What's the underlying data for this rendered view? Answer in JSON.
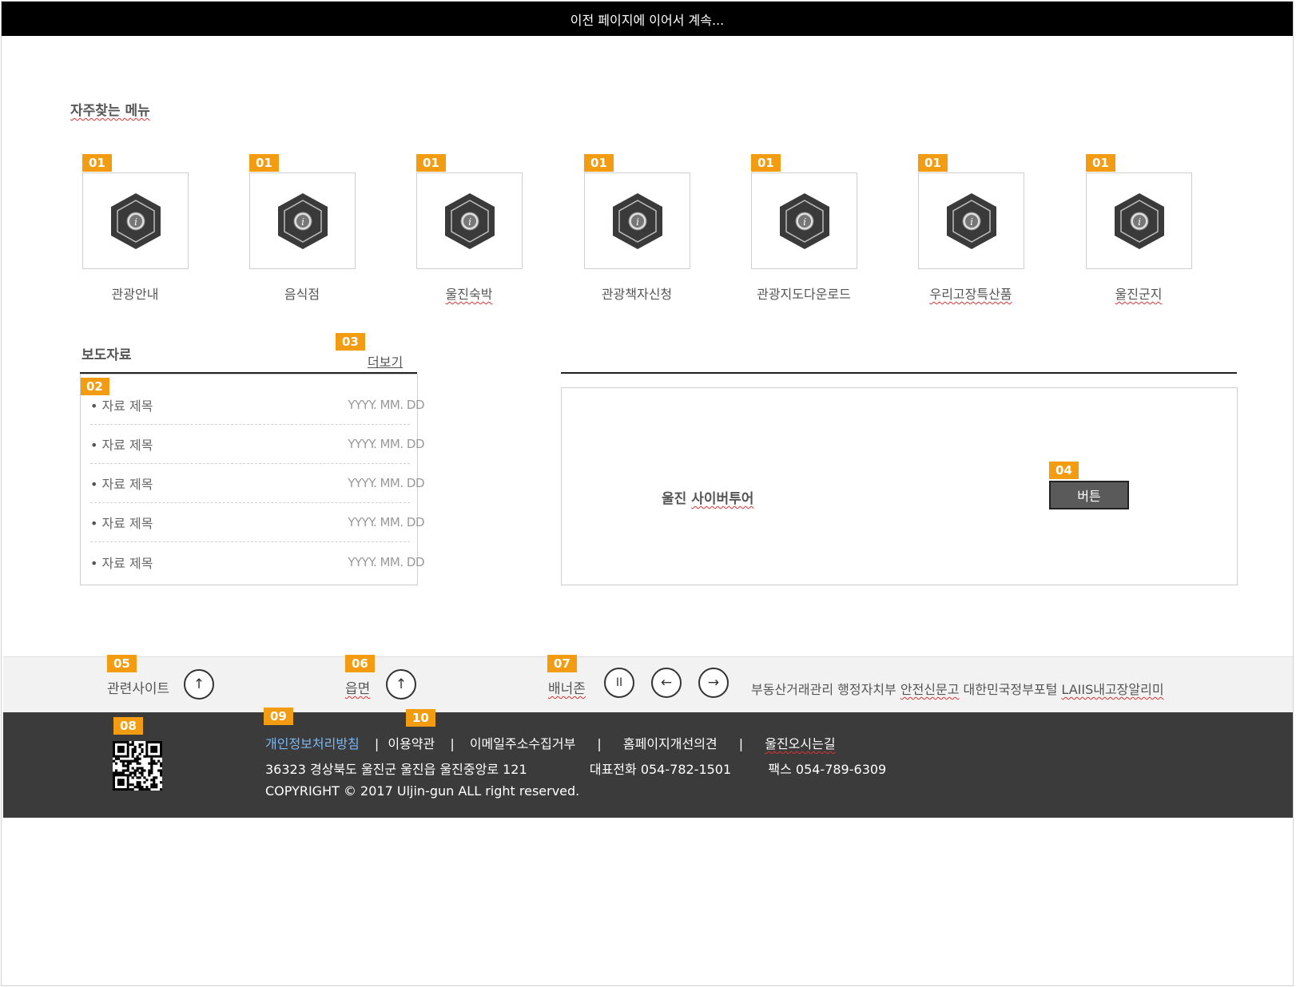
{
  "top_bar": {
    "text": "이전 페이지에 이어서 계속..."
  },
  "quick_menu": {
    "title": "자주찾는 메뉴",
    "items": [
      {
        "badge": "01",
        "label": "관광안내",
        "icon": "info-hexagon-icon"
      },
      {
        "badge": "01",
        "label": "음식점",
        "icon": "info-hexagon-icon"
      },
      {
        "badge": "01",
        "label": "울진숙박",
        "icon": "info-hexagon-icon"
      },
      {
        "badge": "01",
        "label": "관광책자신청",
        "icon": "info-hexagon-icon"
      },
      {
        "badge": "01",
        "label": "관광지도다운로드",
        "icon": "info-hexagon-icon"
      },
      {
        "badge": "01",
        "label": "우리고장특산품",
        "icon": "info-hexagon-icon"
      },
      {
        "badge": "01",
        "label": "울진군지",
        "icon": "info-hexagon-icon"
      }
    ]
  },
  "press": {
    "title": "보도자료",
    "more_badge": "03",
    "more_label": "더보기",
    "list_badge": "02",
    "items": [
      {
        "title": "자료 제목",
        "date": "YYYY. MM. DD"
      },
      {
        "title": "자료 제목",
        "date": "YYYY. MM. DD"
      },
      {
        "title": "자료 제목",
        "date": "YYYY. MM. DD"
      },
      {
        "title": "자료 제목",
        "date": "YYYY. MM. DD"
      },
      {
        "title": "자료 제목",
        "date": "YYYY. MM. DD"
      }
    ]
  },
  "cyber_tour": {
    "title_prefix": "울진 ",
    "title_rest": "사이버투어",
    "button_badge": "04",
    "button_label": "버튼"
  },
  "link_bar": {
    "related": {
      "badge": "05",
      "label": "관련사이트",
      "icon": "arrow-up-icon",
      "glyph": "↑"
    },
    "town": {
      "badge": "06",
      "label": "읍면",
      "icon": "arrow-up-icon",
      "glyph": "↑"
    },
    "banner": {
      "badge": "07",
      "label": "배너존",
      "pause_glyph": "II",
      "prev_glyph": "←",
      "next_glyph": "→",
      "items": [
        "부동산거래관리",
        "행정자치부",
        "안전신문고",
        "대한민국정부포털",
        "LAIIS내고장알리미"
      ]
    }
  },
  "footer": {
    "qr_badge": "08",
    "privacy_badge": "09",
    "terms_badge": "10",
    "links": [
      {
        "label": "개인정보처리방침",
        "highlight": true
      },
      {
        "label": "이용약관"
      },
      {
        "label": "이메일주소수집거부"
      },
      {
        "label": "홈페이지개선의견"
      },
      {
        "label": "울진오시는길"
      }
    ],
    "address": "36323 경상북도 울진군 울진읍 울진중앙로 121",
    "phone": "대표전화 054-782-1501",
    "fax": "팩스 054-789-6309",
    "copyright": "COPYRIGHT © 2017 Uljin-gun ALL right reserved.",
    "colors": {
      "background": "#3b3b3b",
      "highlight_link": "#7ab8f5"
    }
  },
  "colors": {
    "badge": "#f39c12",
    "top_bar": "#000000",
    "link_bar_bg": "#f2f2f2"
  }
}
